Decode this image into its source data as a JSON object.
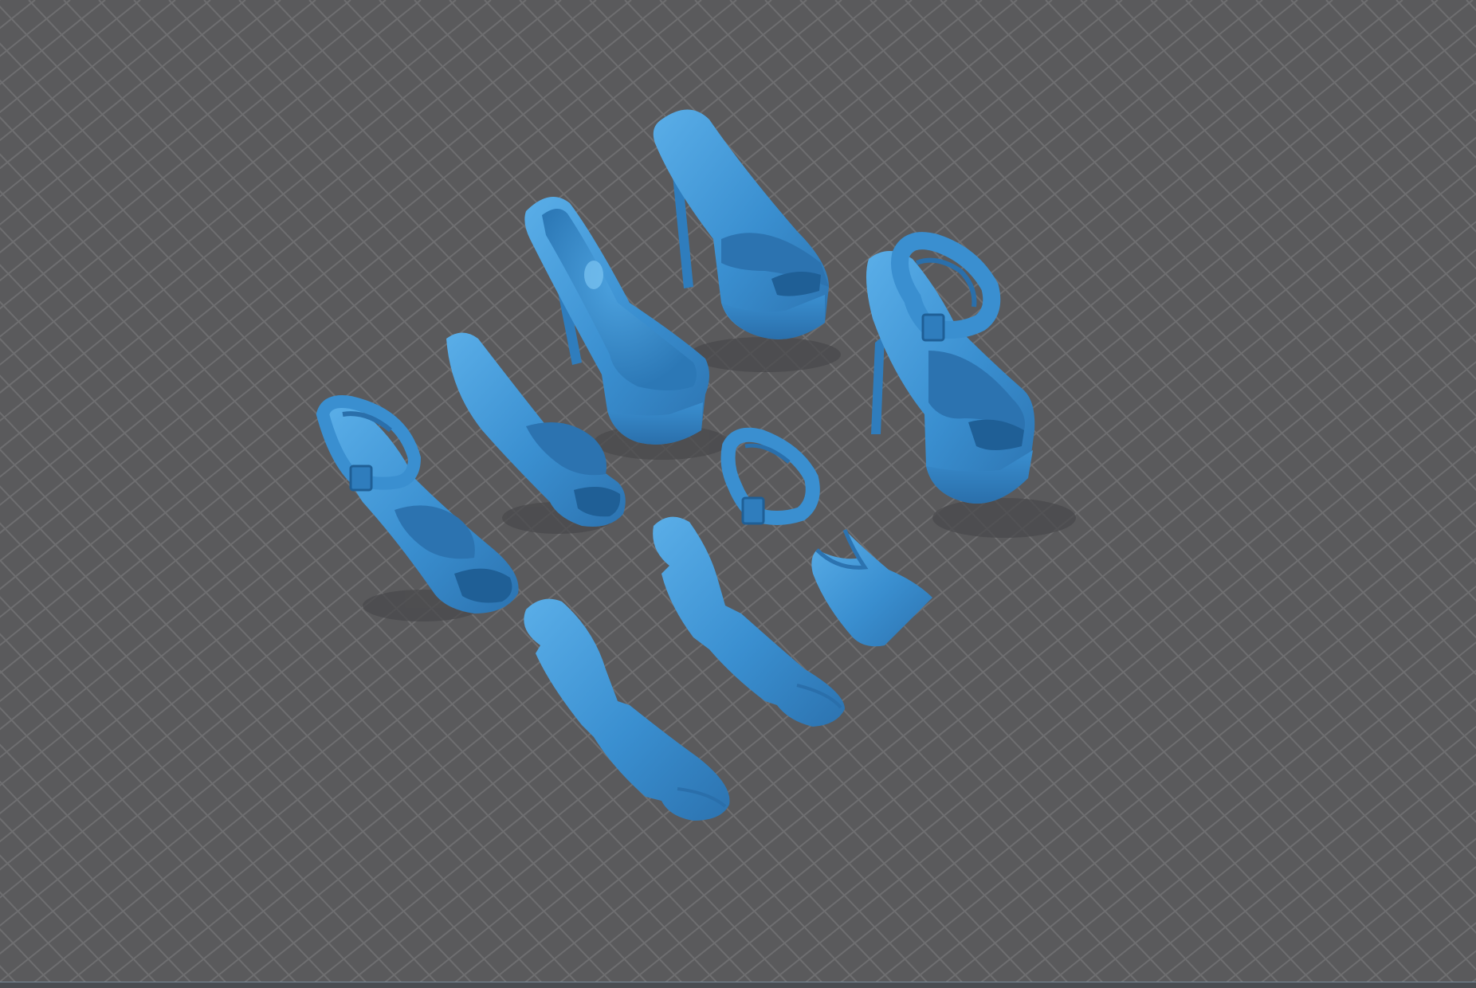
{
  "viewport": {
    "background_color": "#5a5a5c",
    "grid_color": "#6e6e70",
    "grid_shade_color": "#505052"
  },
  "model": {
    "body_color": "#3a8fd0",
    "light_color": "#5aaee8",
    "shade_color": "#2c73b0",
    "dark_color": "#1f5f96",
    "shadow_color": "#4a4a4c"
  },
  "objects": [
    {
      "name": "heel-sandal-top",
      "kind": "platform-heel"
    },
    {
      "name": "heel-pump-open",
      "kind": "platform-heel"
    },
    {
      "name": "heel-strap-right",
      "kind": "platform-heel-with-ankle-strap"
    },
    {
      "name": "sandal-strap-left",
      "kind": "sandal-with-ankle-strap"
    },
    {
      "name": "insole-upper-left",
      "kind": "insole-with-toe-strap"
    },
    {
      "name": "ankle-strap-piece",
      "kind": "ankle-strap"
    },
    {
      "name": "flat-insole-center",
      "kind": "flat-insole"
    },
    {
      "name": "flat-insole-bottom",
      "kind": "flat-insole"
    },
    {
      "name": "heel-cup-piece",
      "kind": "heel-cup"
    }
  ]
}
